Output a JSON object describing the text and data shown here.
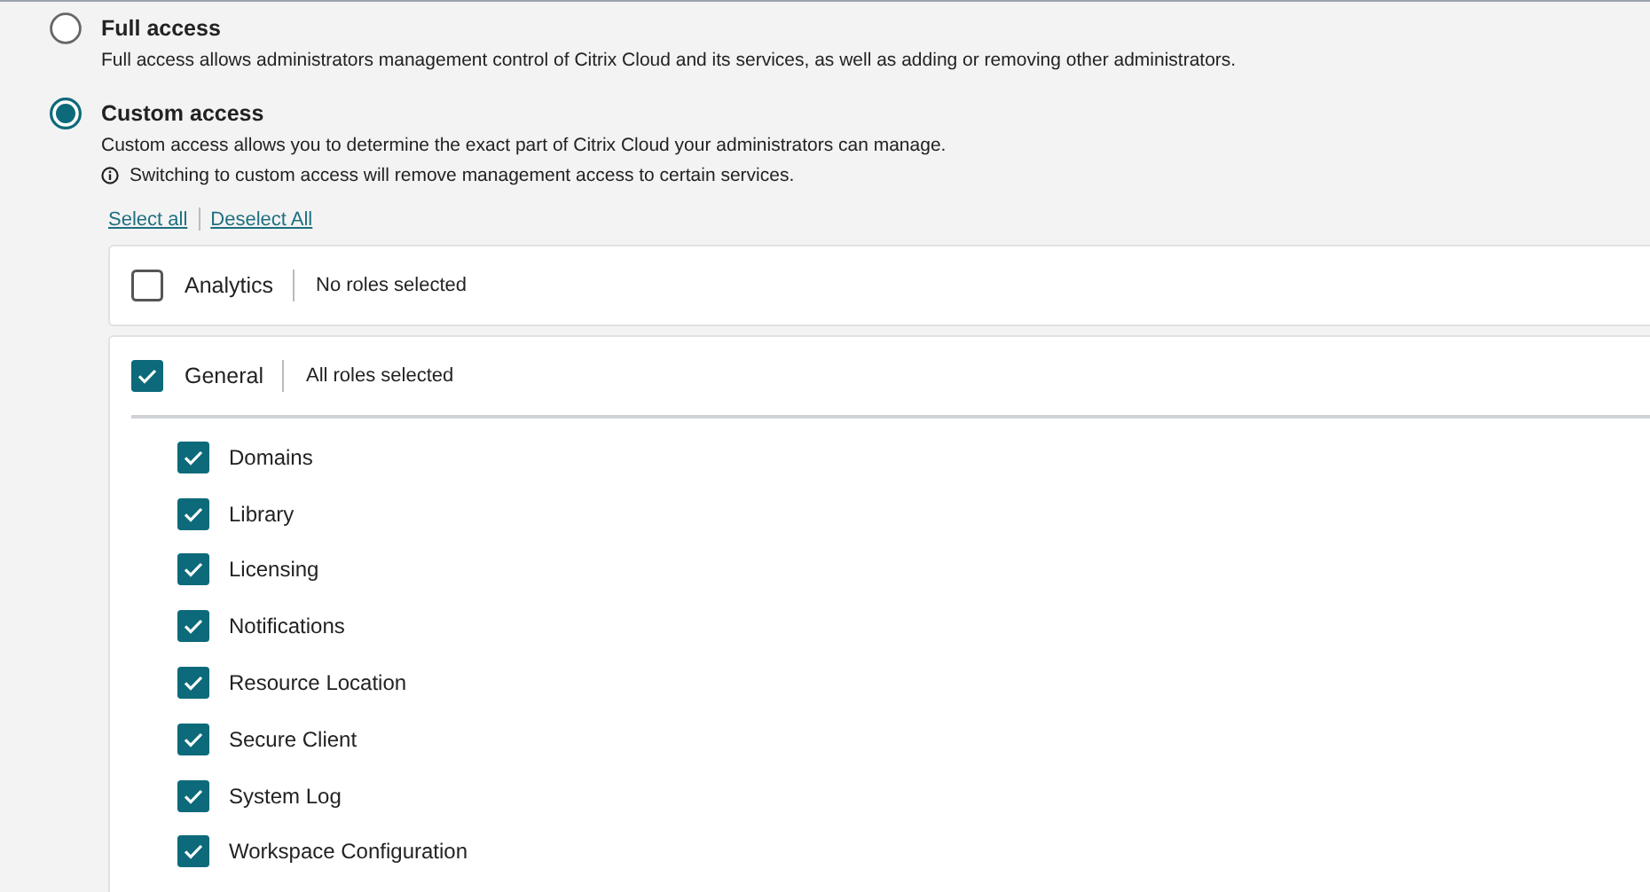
{
  "access_options": [
    {
      "title": "Full access",
      "description": "Full access allows administrators management control of Citrix Cloud and its services, as well as adding or removing other administrators.",
      "selected": false
    },
    {
      "title": "Custom access",
      "description": "Custom access allows you to determine the exact part of Citrix Cloud your administrators can manage.",
      "notice": "Switching to custom access will remove management access to certain services.",
      "selected": true
    }
  ],
  "links": [
    "Select all",
    "Deselect All"
  ],
  "services": [
    {
      "name": "Analytics",
      "checked": false,
      "status": "No roles selected",
      "expanded": false
    },
    {
      "name": "General",
      "checked": true,
      "status": "All roles selected",
      "expanded": true,
      "roles": [
        {
          "name": "Domains",
          "checked": true
        },
        {
          "name": "Library",
          "checked": true
        },
        {
          "name": "Licensing",
          "checked": true
        },
        {
          "name": "Notifications",
          "checked": true
        },
        {
          "name": "Resource Location",
          "checked": true
        },
        {
          "name": "Secure Client",
          "checked": true
        },
        {
          "name": "System Log",
          "checked": true
        },
        {
          "name": "Workspace Configuration",
          "checked": true
        }
      ]
    }
  ]
}
